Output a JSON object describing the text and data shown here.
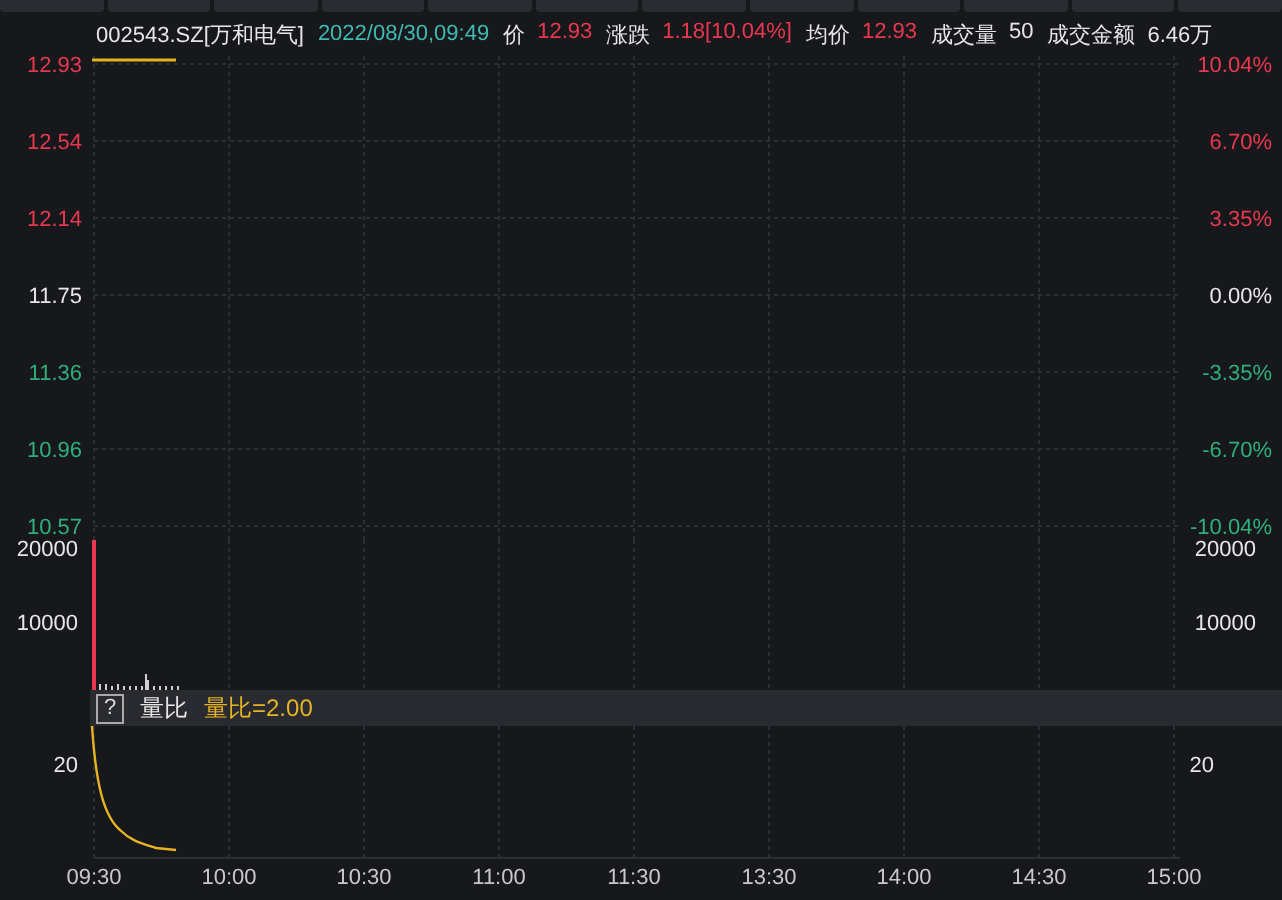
{
  "header": {
    "code": "002543.SZ[万和电气]",
    "datetime": "2022/08/30,09:49",
    "fields": [
      {
        "label": "价",
        "value": "12.93",
        "color": "#e8384f"
      },
      {
        "label": "涨跌",
        "value": "1.18[10.04%]",
        "color": "#e8384f"
      },
      {
        "label": "均价",
        "value": "12.93",
        "color": "#e8384f"
      },
      {
        "label": "成交量",
        "value": "50",
        "color": "#e6e6e6"
      },
      {
        "label": "成交金额",
        "value": "6.46万",
        "color": "#e6e6e6"
      }
    ]
  },
  "price_chart": {
    "left_axis": [
      {
        "label": "12.93",
        "color": "#e8384f"
      },
      {
        "label": "12.54",
        "color": "#e8384f"
      },
      {
        "label": "12.14",
        "color": "#e8384f"
      },
      {
        "label": "11.75",
        "color": "#e6e6e6"
      },
      {
        "label": "11.36",
        "color": "#2fae7c"
      },
      {
        "label": "10.96",
        "color": "#2fae7c"
      },
      {
        "label": "10.57",
        "color": "#2fae7c"
      }
    ],
    "right_axis": [
      {
        "label": "10.04%",
        "color": "#e8384f"
      },
      {
        "label": "6.70%",
        "color": "#e8384f"
      },
      {
        "label": "3.35%",
        "color": "#e8384f"
      },
      {
        "label": "0.00%",
        "color": "#e6e6e6"
      },
      {
        "label": "-3.35%",
        "color": "#2fae7c"
      },
      {
        "label": "-6.70%",
        "color": "#2fae7c"
      },
      {
        "label": "-10.04%",
        "color": "#2fae7c"
      }
    ]
  },
  "volume_chart": {
    "left_axis": [
      "20000",
      "10000"
    ],
    "right_axis": [
      "20000",
      "10000"
    ]
  },
  "indicator": {
    "help": "?",
    "name": "量比",
    "reading": "量比=2.00"
  },
  "ratio_chart": {
    "left_axis": [
      "20"
    ],
    "right_axis": [
      "20"
    ]
  },
  "time_axis": [
    "09:30",
    "10:00",
    "10:30",
    "11:00",
    "11:30",
    "13:30",
    "14:00",
    "14:30",
    "15:00"
  ]
}
